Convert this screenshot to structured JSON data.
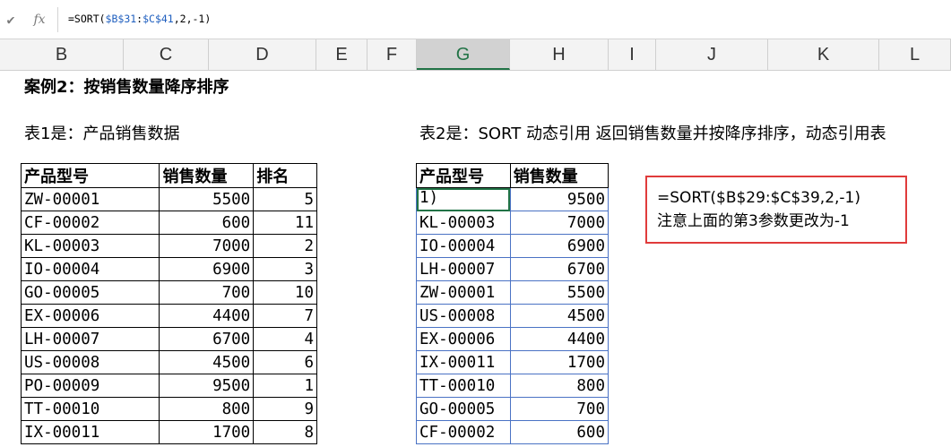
{
  "formula_bar": {
    "formula": {
      "pre": "=SORT(",
      "ref1": "$B$31",
      "colon": ":",
      "ref2": "$C$41",
      "post": ",2,-1)"
    }
  },
  "columns": [
    "B",
    "C",
    "D",
    "E",
    "F",
    "G",
    "H",
    "I",
    "J",
    "K",
    "L"
  ],
  "selected_column": "G",
  "case_title": "案例2：按销售数量降序排序",
  "table1_caption": "表1是：产品销售数据",
  "table2_caption": "表2是：SORT 动态引用 返回销售数量并按降序排序，动态引用表",
  "table1": {
    "headers": [
      "产品型号",
      "销售数量",
      "排名"
    ],
    "rows": [
      [
        "ZW-00001",
        "5500",
        "5"
      ],
      [
        "CF-00002",
        "600",
        "11"
      ],
      [
        "KL-00003",
        "7000",
        "2"
      ],
      [
        "IO-00004",
        "6900",
        "3"
      ],
      [
        "GO-00005",
        "700",
        "10"
      ],
      [
        "EX-00006",
        "4400",
        "7"
      ],
      [
        "LH-00007",
        "6700",
        "4"
      ],
      [
        "US-00008",
        "4500",
        "6"
      ],
      [
        "PO-00009",
        "9500",
        "1"
      ],
      [
        "TT-00010",
        "800",
        "9"
      ],
      [
        "IX-00011",
        "1700",
        "8"
      ]
    ]
  },
  "table2": {
    "headers": [
      "产品型号",
      "销售数量"
    ],
    "rows": [
      [
        "1)",
        "9500"
      ],
      [
        "KL-00003",
        "7000"
      ],
      [
        "IO-00004",
        "6900"
      ],
      [
        "LH-00007",
        "6700"
      ],
      [
        "ZW-00001",
        "5500"
      ],
      [
        "US-00008",
        "4500"
      ],
      [
        "EX-00006",
        "4400"
      ],
      [
        "IX-00011",
        "1700"
      ],
      [
        "TT-00010",
        "800"
      ],
      [
        "GO-00005",
        "700"
      ],
      [
        "CF-00002",
        "600"
      ]
    ]
  },
  "note": {
    "line1": "=SORT($B$29:$C$39,2,-1)",
    "line2": "注意上面的第3参数更改为-1"
  },
  "colors": {
    "accent_green": "#217346",
    "note_border": "#e03b3b",
    "table2_border": "#4a72c4"
  },
  "icons": {
    "confirm": "checkmark-icon",
    "function": "fx-icon"
  }
}
